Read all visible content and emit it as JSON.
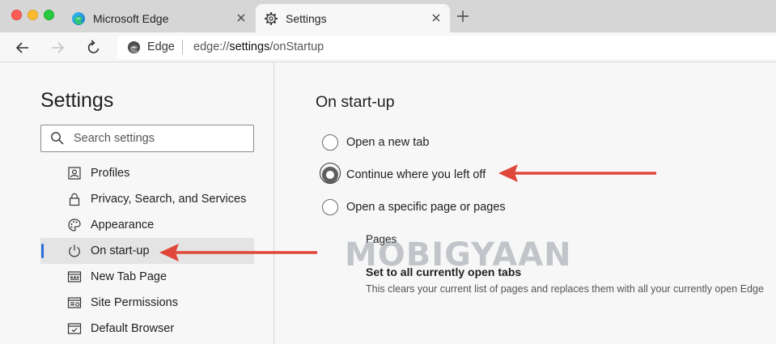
{
  "tabs": [
    {
      "label": "Microsoft Edge",
      "icon": "edge-logo-icon",
      "active": false
    },
    {
      "label": "Settings",
      "icon": "gear-icon",
      "active": true
    }
  ],
  "toolbar": {
    "site_chip": "Edge",
    "url_prefix": "edge://",
    "url_host": "settings",
    "url_path": "/onStartup"
  },
  "sidebar": {
    "title": "Settings",
    "search_placeholder": "Search settings",
    "items": [
      {
        "label": "Profiles",
        "icon": "profile-card-icon",
        "selected": false
      },
      {
        "label": "Privacy, Search, and Services",
        "icon": "lock-icon",
        "selected": false
      },
      {
        "label": "Appearance",
        "icon": "palette-icon",
        "selected": false
      },
      {
        "label": "On start-up",
        "icon": "power-icon",
        "selected": true
      },
      {
        "label": "New Tab Page",
        "icon": "new-tab-page-icon",
        "selected": false
      },
      {
        "label": "Site Permissions",
        "icon": "site-permissions-icon",
        "selected": false
      },
      {
        "label": "Default Browser",
        "icon": "default-browser-icon",
        "selected": false
      }
    ]
  },
  "main": {
    "title": "On start-up",
    "options": [
      {
        "label": "Open a new tab",
        "checked": false
      },
      {
        "label": "Continue where you left off",
        "checked": true
      },
      {
        "label": "Open a specific page or pages",
        "checked": false
      }
    ],
    "pages_heading": "Pages",
    "set_all_heading": "Set to all currently open tabs",
    "set_all_description": "This clears your current list of pages and replaces them with all your currently open Edge"
  },
  "watermark": "MOBIGYAAN",
  "colors": {
    "accent": "#2a6fdb",
    "annotation_arrow": "#e0473b",
    "tab_bar": "#d6d6d6",
    "page_background": "#f7f7f7"
  }
}
